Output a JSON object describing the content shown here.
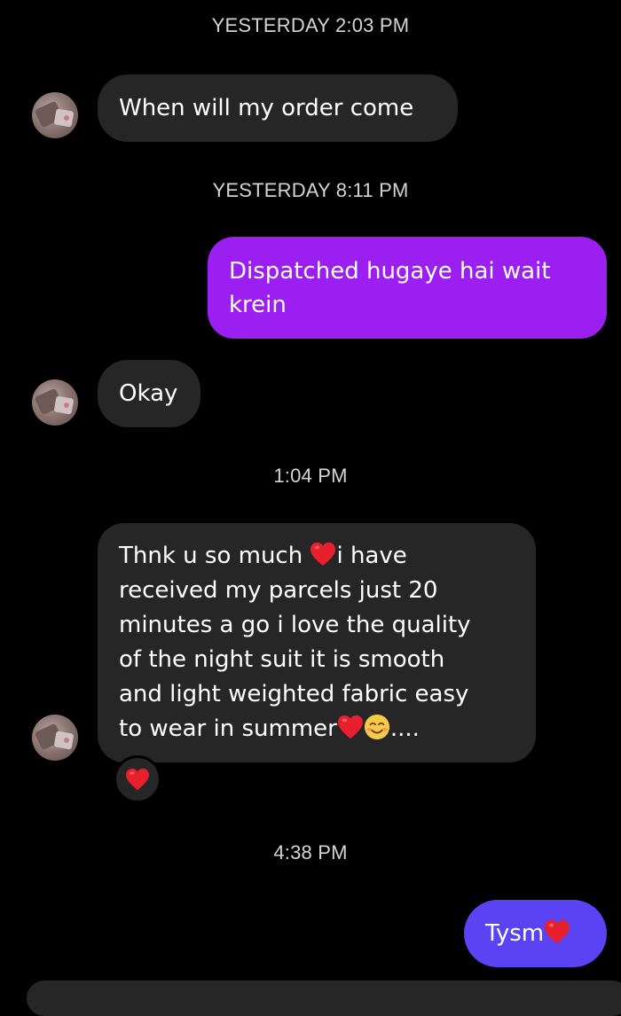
{
  "timestamps": {
    "t1": "YESTERDAY 2:03 PM",
    "t2": "YESTERDAY 8:11 PM",
    "t3": "1:04 PM",
    "t4": "4:38 PM"
  },
  "messages": [
    {
      "sender": "them",
      "text": "When will my order come"
    },
    {
      "sender": "me",
      "text_line1": "Dispatched hugaye hai wait",
      "text_line2": "krein"
    },
    {
      "sender": "them",
      "text": "Okay"
    },
    {
      "sender": "them",
      "line1_a": "Thnk u so much ",
      "line1_b": "i have",
      "line2": "received my parcels just 20",
      "line3": "minutes a go i love the quality",
      "line4": "of the night suit it is smooth",
      "line5": "and light weighted fabric  easy",
      "line6_a": "to wear in summer",
      "line6_b": "....",
      "reaction": "heart-emoji"
    },
    {
      "sender": "me",
      "text": "Tysm"
    }
  ],
  "colors": {
    "background": "#000000",
    "received_bubble": "#262626",
    "sent_bubble_purple": "#9a1ff0",
    "sent_bubble_blue": "#5b42f3",
    "heart": "#e8202e"
  }
}
